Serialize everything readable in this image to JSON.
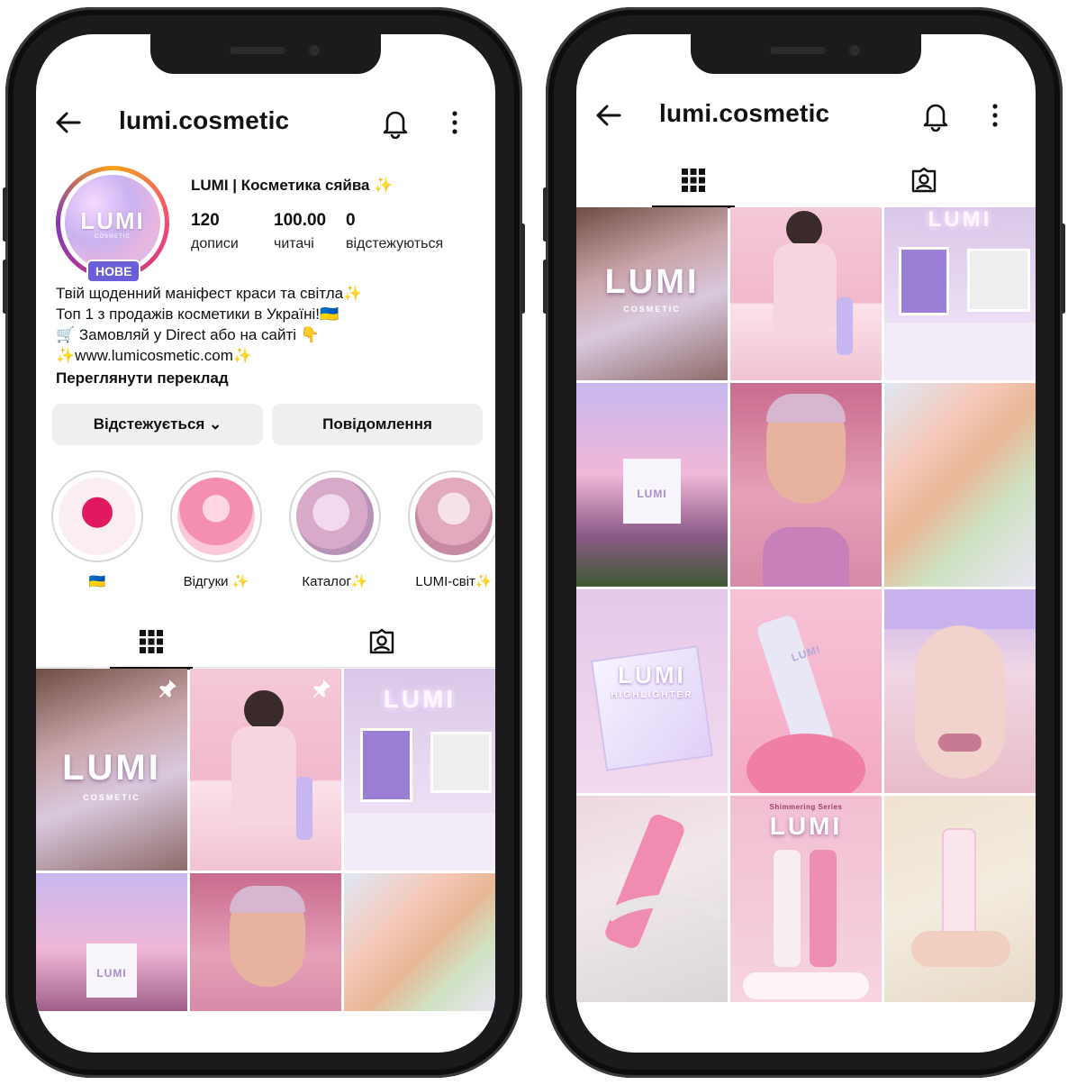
{
  "left": {
    "username": "lumi.cosmetic",
    "profile_name": "LUMI | Косметика сяйва ✨",
    "avatar_logo": "LUMI",
    "avatar_sub": "COSMETIC",
    "badge": "НОВЕ",
    "stats": [
      {
        "value": "120",
        "label": "дописи"
      },
      {
        "value": "100.00",
        "label": "читачі"
      },
      {
        "value": "0",
        "label": "відстежуються"
      }
    ],
    "bio": [
      "Твій щоденний маніфест краси та світла✨",
      "Топ 1 з продажів косметики в Україні!🇺🇦",
      "🛒 Замовляй у Direct або на сайті 👇",
      "✨www.lumicosmetic.com✨"
    ],
    "translate": "Переглянути переклад",
    "follow_button": "Відстежується ⌄",
    "message_button": "Повідомлення",
    "highlights": [
      {
        "caption": "🇺🇦"
      },
      {
        "caption": "Відгуки ✨"
      },
      {
        "caption": "Каталог✨"
      },
      {
        "caption": "LUMI-світ✨"
      }
    ],
    "grid_logo": "LUMI",
    "grid_logo_sub": "COSMETIC",
    "grid_neon": "LUMI",
    "grid_bag": "LUMI"
  },
  "right": {
    "username": "lumi.cosmetic",
    "grid_logo": "LUMI",
    "grid_logo_sub": "COSMETIC",
    "grid_neon": "LUMI",
    "grid_bag": "LUMI",
    "box_brand": "LUMI",
    "box_product": "HIGHLIGHTER",
    "tube_label": "LUMI",
    "poster_title": "Shimmering Series",
    "poster_brand": "LUMI"
  },
  "colors": {
    "badge_bg": "#6a5fd8",
    "button_bg": "#efeff1",
    "phone_frame": "#1b1b1d"
  },
  "icons": [
    "back-arrow-icon",
    "bell-icon",
    "more-icon",
    "grid-icon",
    "tagged-icon",
    "pin-icon"
  ]
}
